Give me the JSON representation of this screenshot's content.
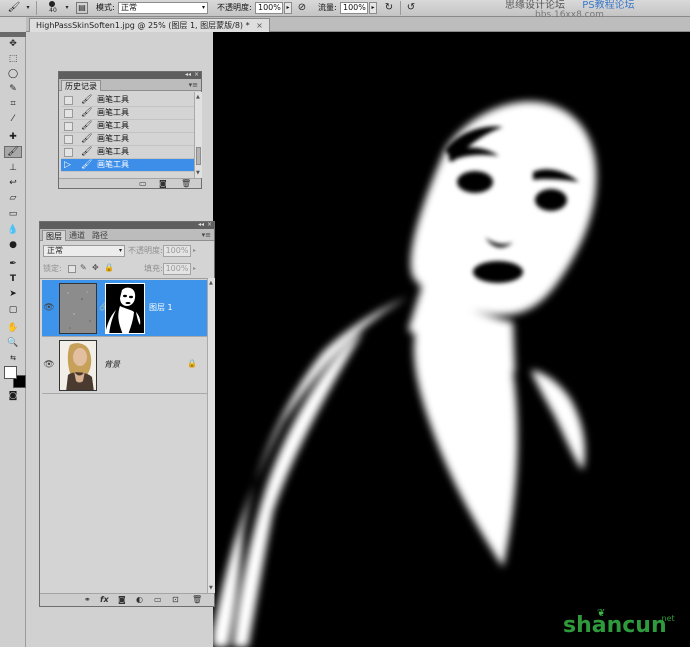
{
  "options_bar": {
    "tool_icon": "brush-icon",
    "brush_size": "40",
    "mode_label": "模式:",
    "mode_value": "正常",
    "opacity_label": "不透明度:",
    "opacity_value": "100%",
    "flow_label": "流量:",
    "flow_value": "100%",
    "site_watermark": "思缘设计论坛",
    "site_watermark2": "PS教程论坛",
    "site_watermark3": "bbs.16xx8.com"
  },
  "document": {
    "tab_title": "HighPassSkinSoften1.jpg @ 25% (图层 1, 图层蒙版/8) *",
    "close_glyph": "×"
  },
  "toolbox": {
    "tools": [
      "move-icon",
      "marquee-icon",
      "lasso-icon",
      "quick-select-icon",
      "crop-icon",
      "eyedropper-icon",
      "healing-icon",
      "brush-icon",
      "stamp-icon",
      "history-brush-icon",
      "eraser-icon",
      "gradient-icon",
      "blur-icon",
      "dodge-icon",
      "pen-icon",
      "type-icon",
      "path-select-icon",
      "shape-icon",
      "hand-icon",
      "zoom-icon"
    ],
    "active_tool": "brush-icon",
    "foreground_color": "#ffffff",
    "background_color": "#000000"
  },
  "history_panel": {
    "tab_label": "历史记录",
    "rows": [
      {
        "label": "画笔工具",
        "selected": false
      },
      {
        "label": "画笔工具",
        "selected": false
      },
      {
        "label": "画笔工具",
        "selected": false
      },
      {
        "label": "画笔工具",
        "selected": false
      },
      {
        "label": "画笔工具",
        "selected": false
      },
      {
        "label": "画笔工具",
        "selected": true
      }
    ]
  },
  "layers_panel": {
    "tabs": [
      "图层",
      "通道",
      "路径"
    ],
    "active_tab": "图层",
    "blend_mode": "正常",
    "opacity_label": "不透明度:",
    "opacity_value": "100%",
    "lock_label": "锁定:",
    "fill_label": "填充:",
    "fill_value": "100%",
    "layers": [
      {
        "name": "图层 1",
        "selected": true,
        "has_mask": true
      },
      {
        "name": "背景",
        "selected": false,
        "locked": true
      }
    ],
    "footer_icons": [
      "link-icon",
      "fx-icon",
      "mask-icon",
      "adjustment-icon",
      "folder-icon",
      "new-layer-icon",
      "trash-icon"
    ]
  },
  "site_logo": {
    "text": "shancun",
    "suffix": ".net",
    "color": "#2e9a3c"
  }
}
